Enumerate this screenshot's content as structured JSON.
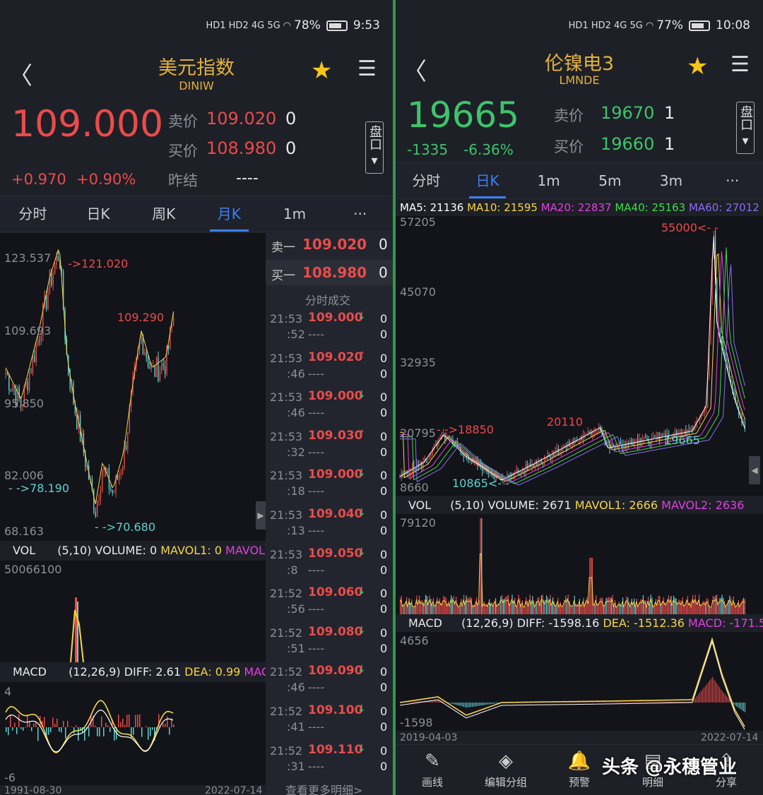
{
  "left": {
    "status": {
      "net": "HD1 HD2 4G 5G",
      "battery": "78%",
      "time": "9:53",
      "batt_level": 0.78
    },
    "title": "美元指数",
    "code": "DINIW",
    "price": "109.000",
    "change": "+0.970",
    "change_pct": "+0.90%",
    "quote": [
      {
        "label": "卖价",
        "value": "109.020",
        "qty": "0"
      },
      {
        "label": "买价",
        "value": "108.980",
        "qty": "0"
      },
      {
        "label": "昨结",
        "value": "----",
        "qty": ""
      }
    ],
    "pan": "盘口",
    "tabs": [
      "分时",
      "日K",
      "周K",
      "月K",
      "1m",
      "···"
    ],
    "active_tab": 3,
    "ylabels": [
      "123.537",
      "109.693",
      "95.850",
      "82.006",
      "68.163"
    ],
    "annot": {
      "high": "->121.020",
      "last": "109.290",
      "low1": "- ->78.190",
      "low2": "- ->70.680"
    },
    "vol_info": {
      "vol": "VOL",
      "params": "(5,10)",
      "volume": "VOLUME: 0",
      "mavol1": "MAVOL1: 0",
      "mavol2": "MAVOL"
    },
    "vol_max": "50066100",
    "macd_info": {
      "name": "MACD",
      "params": "(12,26,9)",
      "diff": "DIFF: 2.61",
      "dea": "DEA: 0.99",
      "macd": "MAC"
    },
    "macd_top": "4",
    "macd_bottom": "-6",
    "dates": [
      "1991-08-30",
      "2022-07-14"
    ],
    "book": [
      {
        "label": "卖一",
        "price": "109.020",
        "qty": "0"
      },
      {
        "label": "买一",
        "price": "108.980",
        "qty": "0"
      }
    ],
    "trades_title": "分时成交",
    "trades": [
      {
        "t1": "21:53",
        "t2": ":52",
        "price": "109.000",
        "dir": "↓",
        "q1": "0",
        "q2": "0",
        "c": "#3dc46b"
      },
      {
        "t1": "21:53",
        "t2": ":46",
        "price": "109.020",
        "dir": "↑",
        "q1": "0",
        "q2": "0",
        "c": "#ea4b4b"
      },
      {
        "t1": "21:53",
        "t2": ":46",
        "price": "109.000",
        "dir": "↓",
        "q1": "0",
        "q2": "0",
        "c": "#3dc46b"
      },
      {
        "t1": "21:53",
        "t2": ":32",
        "price": "109.030",
        "dir": "↑",
        "q1": "0",
        "q2": "0",
        "c": "#ea4b4b"
      },
      {
        "t1": "21:53",
        "t2": ":18",
        "price": "109.000",
        "dir": "↓",
        "q1": "0",
        "q2": "0",
        "c": "#3dc46b"
      },
      {
        "t1": "21:53",
        "t2": ":13",
        "price": "109.040",
        "dir": "↓",
        "q1": "0",
        "q2": "0",
        "c": "#3dc46b"
      },
      {
        "t1": "21:53",
        "t2": ":8",
        "price": "109.050",
        "dir": "↓",
        "q1": "0",
        "q2": "0",
        "c": "#3dc46b"
      },
      {
        "t1": "21:52",
        "t2": ":56",
        "price": "109.060",
        "dir": "↓",
        "q1": "0",
        "q2": "0",
        "c": "#3dc46b"
      },
      {
        "t1": "21:52",
        "t2": ":51",
        "price": "109.080",
        "dir": "↓",
        "q1": "0",
        "q2": "0",
        "c": "#3dc46b"
      },
      {
        "t1": "21:52",
        "t2": ":46",
        "price": "109.090",
        "dir": "↓",
        "q1": "0",
        "q2": "0",
        "c": "#3dc46b"
      },
      {
        "t1": "21:52",
        "t2": ":41",
        "price": "109.100",
        "dir": "↓",
        "q1": "0",
        "q2": "0",
        "c": "#3dc46b"
      },
      {
        "t1": "21:52",
        "t2": ":31",
        "price": "109.110",
        "dir": "↓",
        "q1": "0",
        "q2": "0",
        "c": "#3dc46b"
      }
    ],
    "trade_dash": "----",
    "more": "查看更多明细>"
  },
  "right": {
    "status": {
      "net": "HD1 HD2 4G 5G",
      "battery": "77%",
      "time": "10:08",
      "batt_level": 0.77
    },
    "title": "伦镍电3",
    "code": "LMNDE",
    "price": "19665",
    "change": "-1335",
    "change_pct": "-6.36%",
    "quote": [
      {
        "label": "卖价",
        "value": "19670",
        "qty": "1"
      },
      {
        "label": "买价",
        "value": "19660",
        "qty": "1"
      }
    ],
    "pan": "盘口",
    "tabs": [
      "分时",
      "日K",
      "1m",
      "5m",
      "3m",
      "···"
    ],
    "active_tab": 1,
    "ma": [
      {
        "t": "MA5: 21136",
        "c": "#ffffff"
      },
      {
        "t": "MA10: 21595",
        "c": "#f5d547"
      },
      {
        "t": "MA20: 22837",
        "c": "#e040e0"
      },
      {
        "t": "MA40: 25163",
        "c": "#3ddc4a"
      },
      {
        "t": "MA60: 27012",
        "c": "#8a6cf0"
      }
    ],
    "ylabels": [
      "57205",
      "45070",
      "32935",
      "20795",
      "8660"
    ],
    "annot": {
      "high": "55000<- -",
      "left": "- ->18850",
      "mid": "20110",
      "last": "19665",
      "low": "10865<- -"
    },
    "vol_info": {
      "vol": "VOL",
      "params": "(5,10)",
      "volume": "VOLUME: 2671",
      "mavol1": "MAVOL1: 2666",
      "mavol2": "MAVOL2: 2636"
    },
    "vol_max": "79120",
    "macd_info": {
      "name": "MACD",
      "params": "(12,26,9)",
      "diff": "DIFF: -1598.16",
      "dea": "DEA: -1512.36",
      "macd": "MACD: -171.5"
    },
    "macd_top": "4656",
    "macd_bottom": "-1598",
    "dates": [
      "2019-04-03",
      "2022-07-14"
    ],
    "nav": [
      {
        "icon": "✎",
        "label": "画线"
      },
      {
        "icon": "◈",
        "label": "编辑分组"
      },
      {
        "icon": "🔔",
        "label": "预警"
      },
      {
        "icon": "▤",
        "label": "明细"
      },
      {
        "icon": "⇪",
        "label": "分享"
      }
    ],
    "watermark": "头条 @永穗管业"
  },
  "chart_data": [
    {
      "type": "candlestick",
      "title": "美元指数 DINIW 月K",
      "x_range": [
        "1991-08-30",
        "2022-07-14"
      ],
      "ylim": [
        68.163,
        123.537
      ],
      "labels": {
        "high": 121.02,
        "low": 70.68,
        "low2": 78.19,
        "recent_high": 109.29
      }
    },
    {
      "type": "candlestick",
      "title": "伦镍电3 LMNDE 日K",
      "x_range": [
        "2019-04-03",
        "2022-07-14"
      ],
      "ylim": [
        8660,
        57205
      ],
      "labels": {
        "high": 55000,
        "low": 10865,
        "point1": 18850,
        "point2": 20110,
        "last": 19665
      },
      "ma": {
        "MA5": 21136,
        "MA10": 21595,
        "MA20": 22837,
        "MA40": 25163,
        "MA60": 27012
      }
    }
  ]
}
